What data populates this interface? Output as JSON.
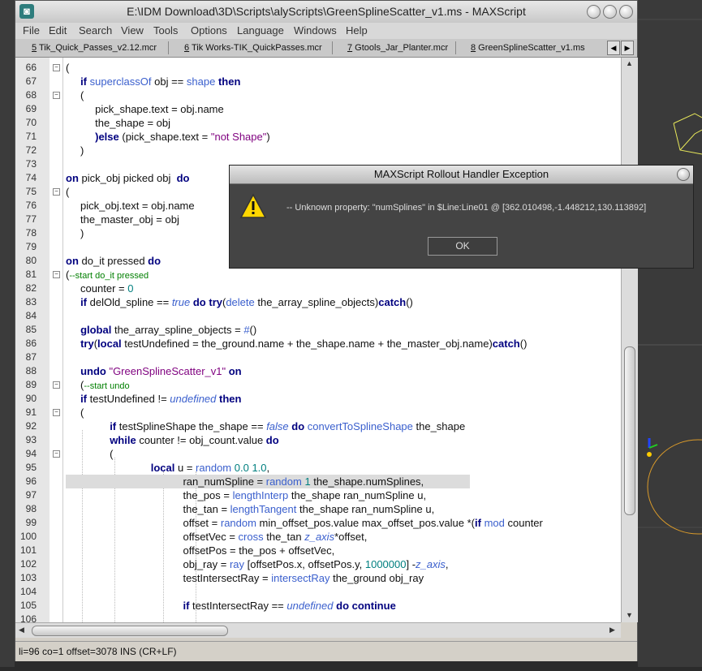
{
  "window": {
    "title": "E:\\IDM Download\\3D\\Scripts\\alyScripts\\GreenSplineScatter_v1.ms - MAXScript"
  },
  "menu": [
    "File",
    "Edit",
    "Search",
    "View",
    "Tools",
    "Options",
    "Language",
    "Windows",
    "Help"
  ],
  "tabs": [
    {
      "num": "5",
      "label": " Tik_Quick_Passes_v2.12.mcr"
    },
    {
      "num": "6",
      "label": " Tik Works-TIK_QuickPasses.mcr"
    },
    {
      "num": "7",
      "label": " Gtools_Jar_Planter.mcr"
    },
    {
      "num": "8",
      "label": " GreenSplineScatter_v1.ms"
    }
  ],
  "lines": [
    {
      "n": "66",
      "fold": "-",
      "html": "("
    },
    {
      "n": "67",
      "fold": "",
      "html": "&nbsp;&nbsp;&nbsp;&nbsp;&nbsp;<span class='kw'>if</span> <span class='fn'>superclassOf</span> obj == <span class='fn'>shape</span> <span class='kw'>then</span>"
    },
    {
      "n": "68",
      "fold": "-",
      "html": "&nbsp;&nbsp;&nbsp;&nbsp;&nbsp;("
    },
    {
      "n": "69",
      "fold": "",
      "html": "&nbsp;&nbsp;&nbsp;&nbsp;&nbsp;&nbsp;&nbsp;&nbsp;&nbsp;&nbsp;pick_shape.text = obj.name"
    },
    {
      "n": "70",
      "fold": "",
      "html": "&nbsp;&nbsp;&nbsp;&nbsp;&nbsp;&nbsp;&nbsp;&nbsp;&nbsp;&nbsp;the_shape = obj"
    },
    {
      "n": "71",
      "fold": "",
      "html": "&nbsp;&nbsp;&nbsp;&nbsp;&nbsp;&nbsp;&nbsp;&nbsp;&nbsp;&nbsp;<span class='kw'>)else</span> (pick_shape.text = <span class='st'>\"not Shape\"</span>)"
    },
    {
      "n": "72",
      "fold": "",
      "html": "&nbsp;&nbsp;&nbsp;&nbsp;&nbsp;)"
    },
    {
      "n": "73",
      "fold": "",
      "html": ""
    },
    {
      "n": "74",
      "fold": "",
      "html": "<span class='kw'>on</span> pick_obj picked obj&nbsp; <span class='kw'>do</span>"
    },
    {
      "n": "75",
      "fold": "-",
      "html": "("
    },
    {
      "n": "76",
      "fold": "",
      "html": "&nbsp;&nbsp;&nbsp;&nbsp;&nbsp;pick_obj.text = obj.name"
    },
    {
      "n": "77",
      "fold": "",
      "html": "&nbsp;&nbsp;&nbsp;&nbsp;&nbsp;the_master_obj = obj"
    },
    {
      "n": "78",
      "fold": "",
      "html": "&nbsp;&nbsp;&nbsp;&nbsp;&nbsp;)"
    },
    {
      "n": "79",
      "fold": "",
      "html": ""
    },
    {
      "n": "80",
      "fold": "",
      "html": "<span class='kw'>on</span> do_it pressed <span class='kw'>do</span>"
    },
    {
      "n": "81",
      "fold": "-",
      "html": "(<span class='cm'>--start do_it pressed</span>"
    },
    {
      "n": "82",
      "fold": "",
      "html": "&nbsp;&nbsp;&nbsp;&nbsp;&nbsp;counter = <span class='nm'>0</span>"
    },
    {
      "n": "83",
      "fold": "",
      "html": "&nbsp;&nbsp;&nbsp;&nbsp;&nbsp;<span class='kw'>if</span> delOld_spline == <span class='it'>true</span> <span class='kw'>do</span> <span class='kw'>try</span>(<span class='fn'>delete</span> the_array_spline_objects)<span class='kw'>catch</span>()"
    },
    {
      "n": "84",
      "fold": "",
      "html": ""
    },
    {
      "n": "85",
      "fold": "",
      "html": "&nbsp;&nbsp;&nbsp;&nbsp;&nbsp;<span class='kw'>global</span> the_array_spline_objects = <span class='fn'>#</span>()"
    },
    {
      "n": "86",
      "fold": "",
      "html": "&nbsp;&nbsp;&nbsp;&nbsp;&nbsp;<span class='kw'>try</span>(<span class='kw'>local</span> testUndefined = the_ground.name + the_shape.name + the_master_obj.name)<span class='kw'>catch</span>()"
    },
    {
      "n": "87",
      "fold": "",
      "html": ""
    },
    {
      "n": "88",
      "fold": "",
      "html": "&nbsp;&nbsp;&nbsp;&nbsp;&nbsp;<span class='kw'>undo</span> <span class='st'>\"GreenSplineScatter_v1\"</span> <span class='kw'>on</span>"
    },
    {
      "n": "89",
      "fold": "-",
      "html": "&nbsp;&nbsp;&nbsp;&nbsp;&nbsp;(<span class='cm'>--start undo</span>"
    },
    {
      "n": "90",
      "fold": "",
      "html": "&nbsp;&nbsp;&nbsp;&nbsp;&nbsp;<span class='kw'>if</span> testUndefined != <span class='it'>undefined</span> <span class='kw'>then</span>"
    },
    {
      "n": "91",
      "fold": "-",
      "html": "&nbsp;&nbsp;&nbsp;&nbsp;&nbsp;("
    },
    {
      "n": "92",
      "fold": "",
      "html": "&nbsp;&nbsp;&nbsp;&nbsp;&nbsp;&nbsp;&nbsp;&nbsp;&nbsp;&nbsp;&nbsp;&nbsp;&nbsp;&nbsp;&nbsp;<span class='kw'>if</span> testSplineShape the_shape == <span class='it'>false</span> <span class='kw'>do</span> <span class='fn'>convertToSplineShape</span> the_shape"
    },
    {
      "n": "93",
      "fold": "",
      "html": "&nbsp;&nbsp;&nbsp;&nbsp;&nbsp;&nbsp;&nbsp;&nbsp;&nbsp;&nbsp;&nbsp;&nbsp;&nbsp;&nbsp;&nbsp;<span class='kw'>while</span> counter != obj_count.value <span class='kw'>do</span>"
    },
    {
      "n": "94",
      "fold": "-",
      "html": "&nbsp;&nbsp;&nbsp;&nbsp;&nbsp;&nbsp;&nbsp;&nbsp;&nbsp;&nbsp;&nbsp;&nbsp;&nbsp;&nbsp;&nbsp;("
    },
    {
      "n": "95",
      "fold": "",
      "html": "&nbsp;&nbsp;&nbsp;&nbsp;&nbsp;&nbsp;&nbsp;&nbsp;&nbsp;&nbsp;&nbsp;&nbsp;&nbsp;&nbsp;&nbsp;&nbsp;&nbsp;&nbsp;&nbsp;&nbsp;&nbsp;&nbsp;&nbsp;&nbsp;&nbsp;&nbsp;&nbsp;&nbsp;&nbsp;<span class='kw'>local</span> u = <span class='fn'>random</span> <span class='nm'>0.0</span> <span class='nm'>1.0</span>,"
    },
    {
      "n": "96",
      "fold": "",
      "hl": true,
      "html": "&nbsp;&nbsp;&nbsp;&nbsp;&nbsp;&nbsp;&nbsp;&nbsp;&nbsp;&nbsp;&nbsp;&nbsp;&nbsp;&nbsp;&nbsp;&nbsp;&nbsp;&nbsp;&nbsp;&nbsp;&nbsp;&nbsp;&nbsp;&nbsp;&nbsp;&nbsp;&nbsp;&nbsp;&nbsp;&nbsp;&nbsp;&nbsp;&nbsp;&nbsp;&nbsp;&nbsp;&nbsp;&nbsp;&nbsp;&nbsp;ran_numSpline = <span class='fn'>random</span> <span class='nm'>1</span> the_shape.numSplines,"
    },
    {
      "n": "97",
      "fold": "",
      "html": "&nbsp;&nbsp;&nbsp;&nbsp;&nbsp;&nbsp;&nbsp;&nbsp;&nbsp;&nbsp;&nbsp;&nbsp;&nbsp;&nbsp;&nbsp;&nbsp;&nbsp;&nbsp;&nbsp;&nbsp;&nbsp;&nbsp;&nbsp;&nbsp;&nbsp;&nbsp;&nbsp;&nbsp;&nbsp;&nbsp;&nbsp;&nbsp;&nbsp;&nbsp;&nbsp;&nbsp;&nbsp;&nbsp;&nbsp;&nbsp;the_pos = <span class='fn'>lengthInterp</span> the_shape ran_numSpline u,"
    },
    {
      "n": "98",
      "fold": "",
      "html": "&nbsp;&nbsp;&nbsp;&nbsp;&nbsp;&nbsp;&nbsp;&nbsp;&nbsp;&nbsp;&nbsp;&nbsp;&nbsp;&nbsp;&nbsp;&nbsp;&nbsp;&nbsp;&nbsp;&nbsp;&nbsp;&nbsp;&nbsp;&nbsp;&nbsp;&nbsp;&nbsp;&nbsp;&nbsp;&nbsp;&nbsp;&nbsp;&nbsp;&nbsp;&nbsp;&nbsp;&nbsp;&nbsp;&nbsp;&nbsp;the_tan = <span class='fn'>lengthTangent</span> the_shape ran_numSpline u,"
    },
    {
      "n": "99",
      "fold": "",
      "html": "&nbsp;&nbsp;&nbsp;&nbsp;&nbsp;&nbsp;&nbsp;&nbsp;&nbsp;&nbsp;&nbsp;&nbsp;&nbsp;&nbsp;&nbsp;&nbsp;&nbsp;&nbsp;&nbsp;&nbsp;&nbsp;&nbsp;&nbsp;&nbsp;&nbsp;&nbsp;&nbsp;&nbsp;&nbsp;&nbsp;&nbsp;&nbsp;&nbsp;&nbsp;&nbsp;&nbsp;&nbsp;&nbsp;&nbsp;&nbsp;offset = <span class='fn'>random</span> min_offset_pos.value max_offset_pos.value *(<span class='kw'>if</span> <span class='fn'>mod</span> counter"
    },
    {
      "n": "100",
      "fold": "",
      "html": "&nbsp;&nbsp;&nbsp;&nbsp;&nbsp;&nbsp;&nbsp;&nbsp;&nbsp;&nbsp;&nbsp;&nbsp;&nbsp;&nbsp;&nbsp;&nbsp;&nbsp;&nbsp;&nbsp;&nbsp;&nbsp;&nbsp;&nbsp;&nbsp;&nbsp;&nbsp;&nbsp;&nbsp;&nbsp;&nbsp;&nbsp;&nbsp;&nbsp;&nbsp;&nbsp;&nbsp;&nbsp;&nbsp;&nbsp;&nbsp;offsetVec = <span class='fn'>cross</span> the_tan <span class='it'>z_axis</span>*offset,"
    },
    {
      "n": "101",
      "fold": "",
      "html": "&nbsp;&nbsp;&nbsp;&nbsp;&nbsp;&nbsp;&nbsp;&nbsp;&nbsp;&nbsp;&nbsp;&nbsp;&nbsp;&nbsp;&nbsp;&nbsp;&nbsp;&nbsp;&nbsp;&nbsp;&nbsp;&nbsp;&nbsp;&nbsp;&nbsp;&nbsp;&nbsp;&nbsp;&nbsp;&nbsp;&nbsp;&nbsp;&nbsp;&nbsp;&nbsp;&nbsp;&nbsp;&nbsp;&nbsp;&nbsp;offsetPos = the_pos + offsetVec,"
    },
    {
      "n": "102",
      "fold": "",
      "html": "&nbsp;&nbsp;&nbsp;&nbsp;&nbsp;&nbsp;&nbsp;&nbsp;&nbsp;&nbsp;&nbsp;&nbsp;&nbsp;&nbsp;&nbsp;&nbsp;&nbsp;&nbsp;&nbsp;&nbsp;&nbsp;&nbsp;&nbsp;&nbsp;&nbsp;&nbsp;&nbsp;&nbsp;&nbsp;&nbsp;&nbsp;&nbsp;&nbsp;&nbsp;&nbsp;&nbsp;&nbsp;&nbsp;&nbsp;&nbsp;obj_ray = <span class='fn'>ray</span> [offsetPos.x, offsetPos.y, <span class='nm'>1000000</span>] -<span class='it'>z_axis</span>,"
    },
    {
      "n": "103",
      "fold": "",
      "html": "&nbsp;&nbsp;&nbsp;&nbsp;&nbsp;&nbsp;&nbsp;&nbsp;&nbsp;&nbsp;&nbsp;&nbsp;&nbsp;&nbsp;&nbsp;&nbsp;&nbsp;&nbsp;&nbsp;&nbsp;&nbsp;&nbsp;&nbsp;&nbsp;&nbsp;&nbsp;&nbsp;&nbsp;&nbsp;&nbsp;&nbsp;&nbsp;&nbsp;&nbsp;&nbsp;&nbsp;&nbsp;&nbsp;&nbsp;&nbsp;testIntersectRay = <span class='fn'>intersectRay</span> the_ground obj_ray"
    },
    {
      "n": "104",
      "fold": "",
      "html": ""
    },
    {
      "n": "105",
      "fold": "",
      "html": "&nbsp;&nbsp;&nbsp;&nbsp;&nbsp;&nbsp;&nbsp;&nbsp;&nbsp;&nbsp;&nbsp;&nbsp;&nbsp;&nbsp;&nbsp;&nbsp;&nbsp;&nbsp;&nbsp;&nbsp;&nbsp;&nbsp;&nbsp;&nbsp;&nbsp;&nbsp;&nbsp;&nbsp;&nbsp;&nbsp;&nbsp;&nbsp;&nbsp;&nbsp;&nbsp;&nbsp;&nbsp;&nbsp;&nbsp;&nbsp;<span class='kw'>if</span> testIntersectRay == <span class='it'>undefined</span> <span class='kw'>do continue</span>"
    },
    {
      "n": "106",
      "fold": "",
      "html": ""
    }
  ],
  "status": "li=96 co=1 offset=3078 INS (CR+LF)",
  "dialog": {
    "title": "MAXScript Rollout Handler Exception",
    "message": "-- Unknown property: \"numSplines\" in $Line:Line01 @ [362.010498,-1.448212,130.113892]",
    "ok_label": "OK"
  }
}
